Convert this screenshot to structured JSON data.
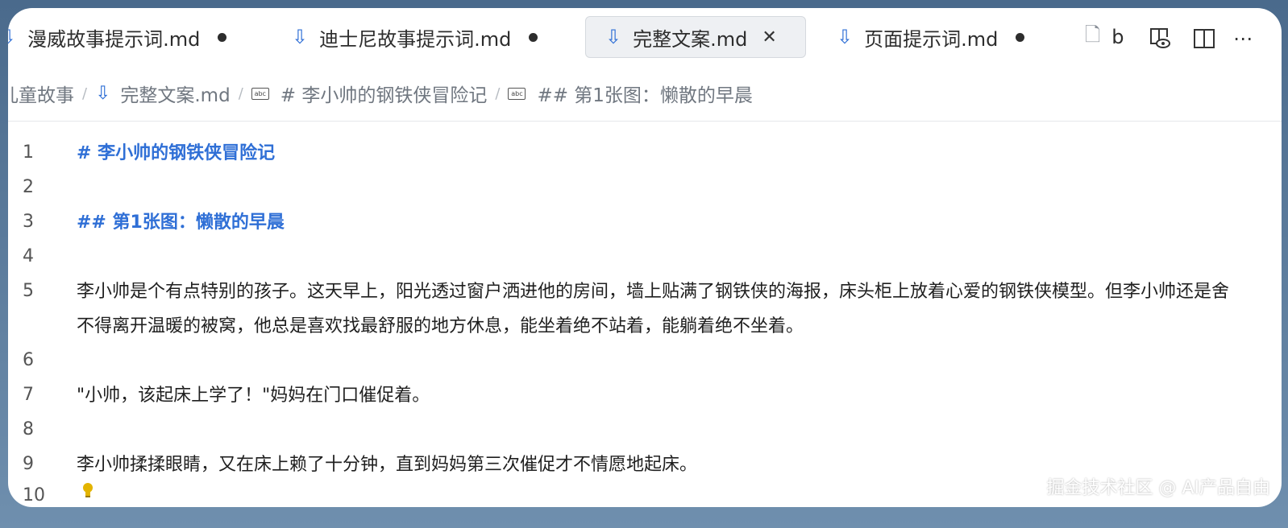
{
  "tabs": [
    {
      "label": "漫威故事提示词.md",
      "modified": true
    },
    {
      "label": "迪士尼故事提示词.md",
      "modified": true
    },
    {
      "label": "完整文案.md",
      "active": true
    },
    {
      "label": "页面提示词.md",
      "modified": true
    },
    {
      "label": "b"
    }
  ],
  "breadcrumb": {
    "folder": "儿童故事",
    "file": "完整文案.md",
    "h1": "# 李小帅的钢铁侠冒险记",
    "h2": "## 第1张图：懒散的早晨"
  },
  "editor": {
    "lines": [
      {
        "n": "1",
        "text": "#  李小帅的钢铁侠冒险记"
      },
      {
        "n": "2",
        "text": ""
      },
      {
        "n": "3",
        "text": "##  第1张图：懒散的早晨"
      },
      {
        "n": "4",
        "text": ""
      },
      {
        "n": "5",
        "text": "李小帅是个有点特别的孩子。这天早上，阳光透过窗户洒进他的房间，墙上贴满了钢铁侠的海报，床头柜上放着心爱的钢铁侠模型。但李小帅还是舍不得离开温暖的被窝，他总是喜欢找最舒服的地方休息，能坐着绝不站着，能躺着绝不坐着。"
      },
      {
        "n": "6",
        "text": ""
      },
      {
        "n": "7",
        "text": "\"小帅，该起床上学了！\"妈妈在门口催促着。"
      },
      {
        "n": "8",
        "text": ""
      },
      {
        "n": "9",
        "text": "李小帅揉揉眼睛，又在床上赖了十分钟，直到妈妈第三次催促才不情愿地起床。"
      },
      {
        "n": "10",
        "text": ""
      }
    ]
  },
  "watermark": "掘金技术社区 @ AI产品自由"
}
